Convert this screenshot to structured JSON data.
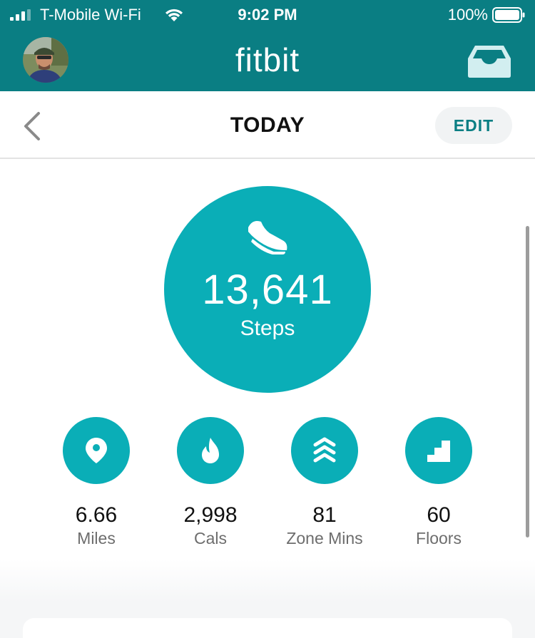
{
  "status_bar": {
    "carrier": "T-Mobile Wi-Fi",
    "time": "9:02 PM",
    "battery": "100%"
  },
  "app_bar": {
    "brand": "fitbit"
  },
  "nav": {
    "title": "TODAY",
    "edit_label": "EDIT"
  },
  "steps": {
    "value": "13,641",
    "label": "Steps"
  },
  "stats": [
    {
      "value": "6.66",
      "label": "Miles",
      "icon": "location-pin-icon"
    },
    {
      "value": "2,998",
      "label": "Cals",
      "icon": "flame-icon"
    },
    {
      "value": "81",
      "label": "Zone Mins",
      "icon": "chevrons-up-icon"
    },
    {
      "value": "60",
      "label": "Floors",
      "icon": "stairs-icon"
    }
  ],
  "colors": {
    "header": "#0a7e83",
    "accent": "#0aaeb7",
    "edit_text": "#0a7e83"
  }
}
